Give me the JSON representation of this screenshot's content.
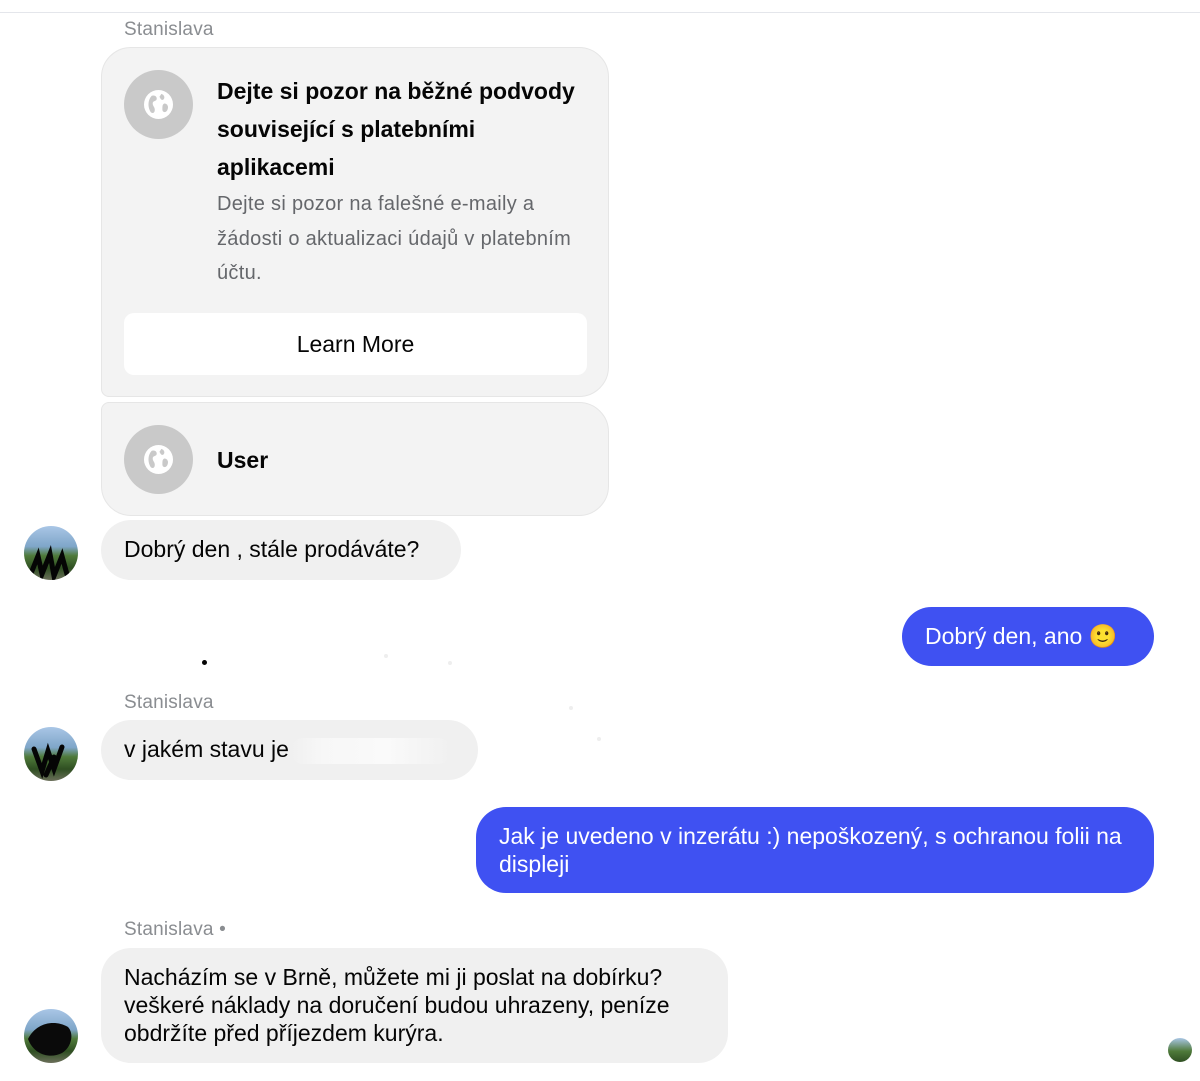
{
  "thread": {
    "sender_name": "Stanislava",
    "sender_name_with_dot": "Stanislava •"
  },
  "card": {
    "title": "Dejte si pozor na běžné podvody související s platebními aplikacemi",
    "description": "Dejte si pozor na falešné e-maily a žádosti o aktualizaci údajů v platebním účtu.",
    "button_label": "Learn More",
    "icon": "globe-icon"
  },
  "user_card": {
    "label": "User",
    "icon": "globe-icon"
  },
  "messages": [
    {
      "direction": "incoming",
      "text": "Dobrý den , stále prodáváte?"
    },
    {
      "direction": "outgoing",
      "text": "Dobrý den, ano 🙂"
    },
    {
      "direction": "incoming",
      "text": "v jakém stavu je"
    },
    {
      "direction": "outgoing",
      "text": "Jak je uvedeno v inzerátu :) nepoškozený, s ochranou folii na displeji"
    },
    {
      "direction": "incoming",
      "text": "Nacházím se v Brně, můžete mi ji poslat na dobírku? veškeré náklady na doručení budou uhrazeny, peníze obdržíte před příjezdem kurýra."
    }
  ],
  "colors": {
    "outgoing_bubble": "#3f51f2",
    "incoming_bubble": "#f0f0f0",
    "card_background": "#f3f3f3"
  }
}
